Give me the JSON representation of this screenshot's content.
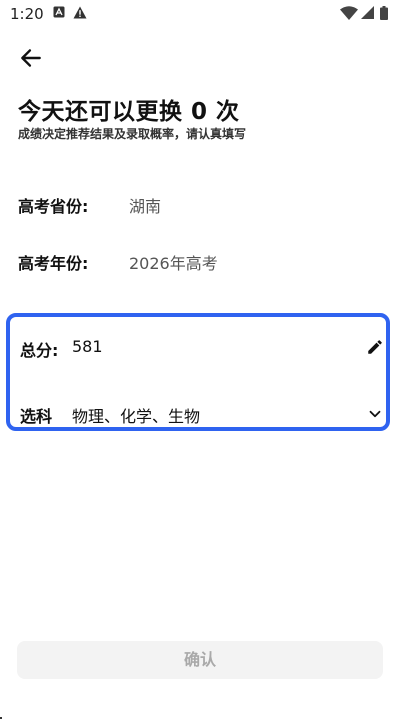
{
  "status_bar": {
    "time": "1:20",
    "icons": [
      "notification-a-icon",
      "warning-icon",
      "wifi-icon",
      "signal-icon",
      "battery-icon"
    ]
  },
  "header": {
    "back_icon": "arrow-left-icon",
    "title": "今天还可以更换 0 次",
    "subtitle": "成绩决定推荐结果及录取概率，请认真填写"
  },
  "form": {
    "province": {
      "label": "高考省份:",
      "value": "湖南"
    },
    "year": {
      "label": "高考年份:",
      "value": "2026年高考"
    },
    "score": {
      "label": "总分:",
      "value": "581",
      "icon": "pencil-icon"
    },
    "subjects": {
      "label": "选科",
      "value": "物理、化学、生物",
      "icon": "chevron-down-icon"
    }
  },
  "confirm_label": "确认",
  "colors": {
    "accent": "#2f63f0",
    "button_bg": "#f3f3f3",
    "button_text": "#a9a9a9"
  }
}
